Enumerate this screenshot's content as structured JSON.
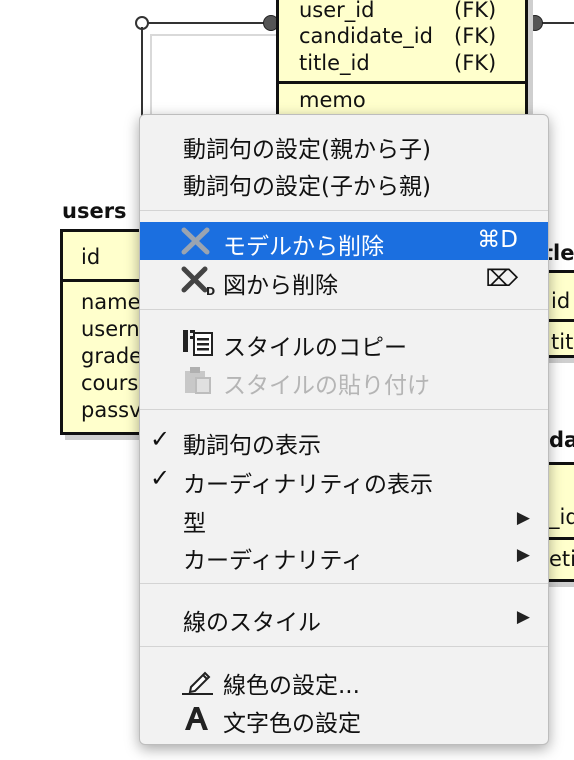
{
  "canvas": {
    "top_entity": {
      "rows": [
        "user_id",
        "candidate_id",
        "title_id"
      ],
      "fk_labels": [
        "(FK)",
        "(FK)",
        "(FK)"
      ],
      "memo": "memo"
    },
    "users_entity": {
      "title": "users",
      "pk": "id",
      "attributes": [
        "name",
        "usern",
        "grade",
        "cours",
        "passv"
      ]
    },
    "title_entity": {
      "title_fragment": "tle",
      "rows": [
        "id",
        "tit"
      ]
    },
    "candidate_entity": {
      "title_fragment": "da",
      "rows": [
        "_id",
        "etir"
      ]
    }
  },
  "menu": {
    "items": [
      {
        "label": "動詞句の設定(親から子)"
      },
      {
        "label": "動詞句の設定(子から親)"
      },
      {
        "label": "モデルから削除",
        "shortcut": "⌘D",
        "icon": "delete-x-icon",
        "highlighted": true
      },
      {
        "label": "図から削除",
        "shortcut": "⌦",
        "icon": "delete-from-diagram-icon"
      },
      {
        "label": "スタイルのコピー",
        "icon": "copy-style-icon"
      },
      {
        "label": "スタイルの貼り付け",
        "icon": "paste-style-icon",
        "disabled": true
      },
      {
        "label": "動詞句の表示",
        "checked": true
      },
      {
        "label": "カーディナリティの表示",
        "checked": true
      },
      {
        "label": "型",
        "submenu": true
      },
      {
        "label": "カーディナリティ",
        "submenu": true
      },
      {
        "label": "線のスタイル",
        "submenu": true
      },
      {
        "label": "線色の設定...",
        "icon": "pencil-icon"
      },
      {
        "label": "文字色の設定",
        "icon": "text-color-icon"
      }
    ],
    "checkmark": "✓",
    "submenu_arrow": "▶"
  },
  "colors": {
    "highlight": "#1b6fe0",
    "entity_fill": "#ffffcc"
  }
}
